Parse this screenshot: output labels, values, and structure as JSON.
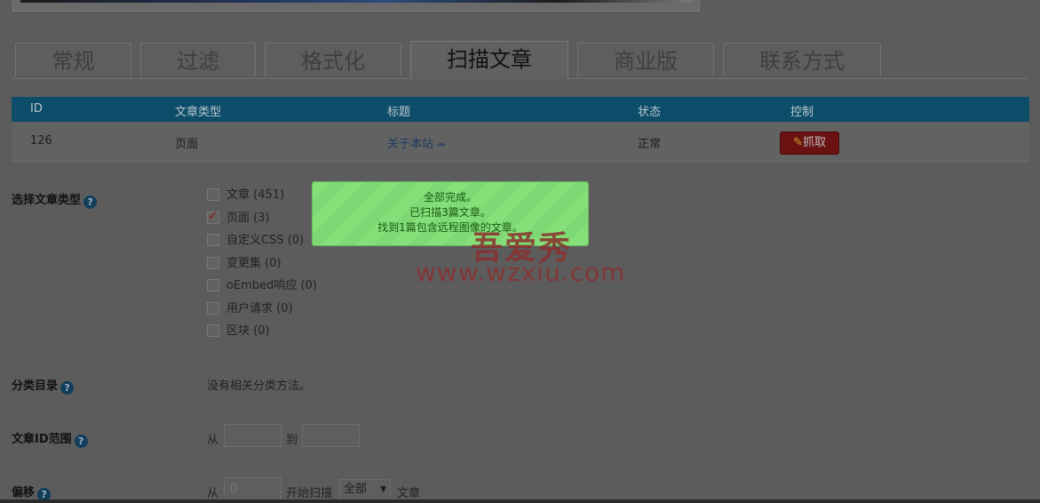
{
  "tabs": [
    "常规",
    "过滤",
    "格式化",
    "扫描文章",
    "商业版",
    "联系方式"
  ],
  "active_tab": "扫描文章",
  "table": {
    "headers": [
      "ID",
      "文章类型",
      "标题",
      "状态",
      "控制"
    ],
    "rows": [
      {
        "id": "126",
        "type": "页面",
        "title": "关于本站",
        "title_icon": "⇛",
        "status": "正常",
        "action": "抓取"
      }
    ]
  },
  "post_types": {
    "label": "选择文章类型",
    "items": [
      {
        "label": "文章 (451)",
        "checked": false
      },
      {
        "label": "页面 (3)",
        "checked": true
      },
      {
        "label": "自定义CSS (0)",
        "checked": false
      },
      {
        "label": "变更集 (0)",
        "checked": false
      },
      {
        "label": "oEmbed响应 (0)",
        "checked": false
      },
      {
        "label": "用户请求 (0)",
        "checked": false
      },
      {
        "label": "区块 (0)",
        "checked": false
      }
    ]
  },
  "category": {
    "label": "分类目录",
    "value": "没有相关分类方法。"
  },
  "id_range": {
    "label": "文章ID范围",
    "from": "从",
    "to": "到",
    "from_value": "",
    "to_value": ""
  },
  "offset": {
    "label": "偏移",
    "from": "从",
    "placeholder": "0",
    "start_scan": "开始扫描",
    "select_value": "全部",
    "suffix": "文章"
  },
  "notice": {
    "line1": "全部完成。",
    "line2": "已扫描3篇文章。",
    "line3": "找到1篇包含远程图像的文章。"
  },
  "watermark": {
    "logo": "吾爱秀",
    "url": "www.wzxiu.com"
  },
  "colors": {
    "header": "#0d4d6a",
    "notice": "#86e07a",
    "button": "#6a1212"
  }
}
